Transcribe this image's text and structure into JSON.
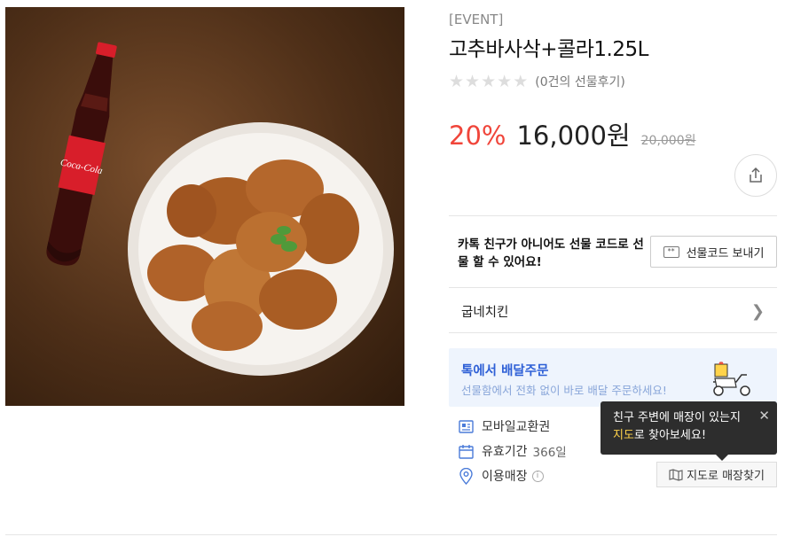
{
  "product": {
    "event_tag": "[EVENT]",
    "title": "고추바사삭+콜라1.25L",
    "image_alt": "Coca-Cola bottle and fried chicken on a plate",
    "rating": {
      "stars": 0,
      "max_stars": 5,
      "review_count_label": "(0건의 선물후기)"
    },
    "price": {
      "discount": "20%",
      "sale": "16,000원",
      "original": "20,000원"
    }
  },
  "share": {
    "icon": "share-icon"
  },
  "gift_code": {
    "message": "카톡 친구가 아니어도 선물 코드로 선물 할 수 있어요!",
    "button_label": "선물코드 보내기"
  },
  "brand": {
    "name": "굽네치킨"
  },
  "delivery": {
    "title": "톡에서 배달주문",
    "subtitle": "선물함에서 전화 없이 바로 배달 주문하세요!"
  },
  "meta": {
    "type": "모바일교환권",
    "validity_label": "유효기간",
    "validity_value": "366일",
    "store_label": "이용매장"
  },
  "tooltip": {
    "line1": "친구 주변에 매장이 있는지",
    "highlight": "지도",
    "line2_rest": "로 찾아보세요!"
  },
  "map_button": {
    "label": "지도로 매장찾기"
  },
  "colors": {
    "discount": "#f0453a",
    "delivery_title": "#2d5fd6",
    "tooltip_highlight": "#ffd34a"
  }
}
